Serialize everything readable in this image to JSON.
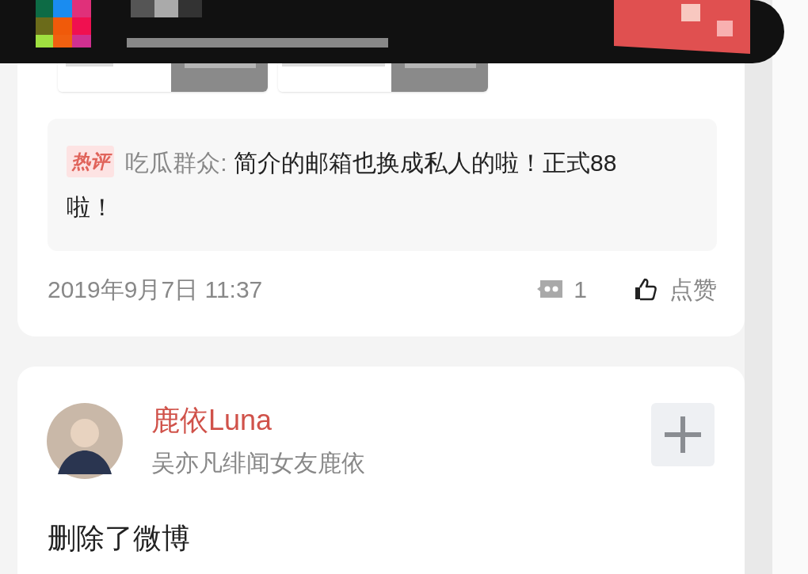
{
  "post": {
    "hot_comment": {
      "badge": "热评",
      "author": "吃瓜群众:",
      "text": "简介的邮箱也换成私人的啦！正式88啦！"
    },
    "time": "2019年9月7日 11:37",
    "comment_count": "1",
    "like_label": "点赞"
  },
  "user_post": {
    "name": "鹿依Luna",
    "bio": "吴亦凡绯闻女友鹿依",
    "text": "删除了微博"
  }
}
